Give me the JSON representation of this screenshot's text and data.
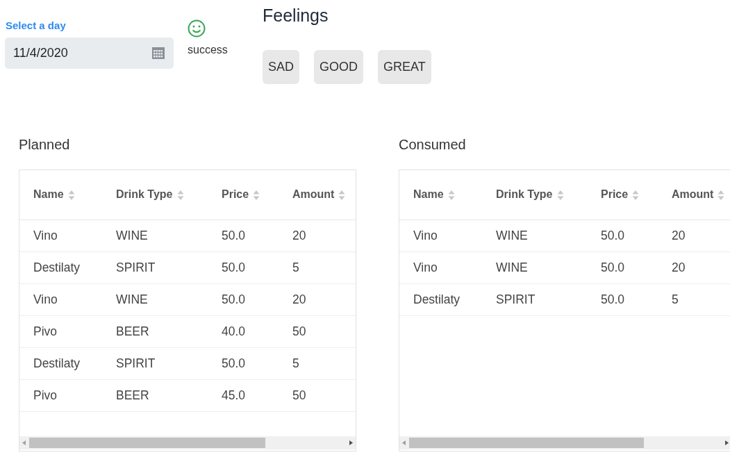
{
  "date_picker": {
    "label": "Select a day",
    "value": "11/4/2020"
  },
  "status": {
    "text": "success"
  },
  "feelings": {
    "title": "Feelings",
    "buttons": [
      {
        "label": "SAD"
      },
      {
        "label": "GOOD"
      },
      {
        "label": "GREAT"
      }
    ]
  },
  "tables": [
    {
      "title": "Planned",
      "columns": [
        "Name",
        "Drink Type",
        "Price",
        "Amount"
      ],
      "rows": [
        [
          "Vino",
          "WINE",
          "50.0",
          "20"
        ],
        [
          "Destilaty",
          "SPIRIT",
          "50.0",
          "5"
        ],
        [
          "Vino",
          "WINE",
          "50.0",
          "20"
        ],
        [
          "Pivo",
          "BEER",
          "40.0",
          "50"
        ],
        [
          "Destilaty",
          "SPIRIT",
          "50.0",
          "5"
        ],
        [
          "Pivo",
          "BEER",
          "45.0",
          "50"
        ]
      ]
    },
    {
      "title": "Consumed",
      "columns": [
        "Name",
        "Drink Type",
        "Price",
        "Amount"
      ],
      "rows": [
        [
          "Vino",
          "WINE",
          "50.0",
          "20"
        ],
        [
          "Vino",
          "WINE",
          "50.0",
          "20"
        ],
        [
          "Destilaty",
          "SPIRIT",
          "50.0",
          "5"
        ]
      ]
    }
  ]
}
